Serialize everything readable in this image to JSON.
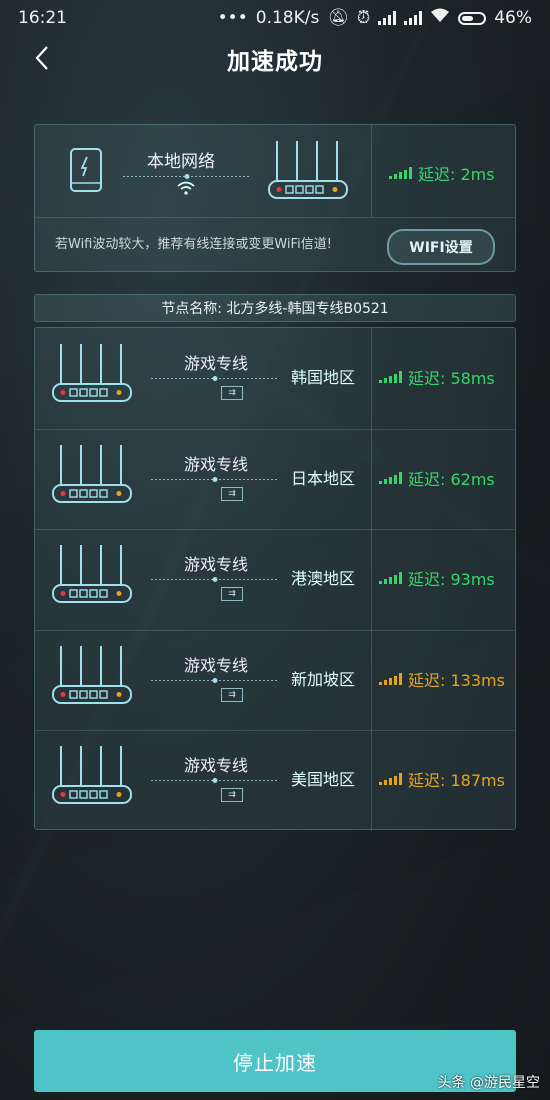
{
  "status_bar": {
    "time": "16:21",
    "network_speed": "0.18K/s",
    "battery": "46%"
  },
  "header": {
    "title": "加速成功",
    "back_icon": "back-chevron-icon"
  },
  "local_network": {
    "label": "本地网络",
    "latency": "延迟: 2ms",
    "latency_color": "#37d46a",
    "tip": "若Wifi波动较大，推荐有线连接或变更WiFi信道!",
    "wifi_button": "WIFI设置"
  },
  "node": {
    "name": "节点名称: 北方多线-韩国专线B0521"
  },
  "routes": [
    {
      "line": "游戏专线",
      "region": "韩国地区",
      "latency": "延迟: 58ms",
      "color": "#37d46a"
    },
    {
      "line": "游戏专线",
      "region": "日本地区",
      "latency": "延迟: 62ms",
      "color": "#37d46a"
    },
    {
      "line": "游戏专线",
      "region": "港澳地区",
      "latency": "延迟: 93ms",
      "color": "#37d46a"
    },
    {
      "line": "游戏专线",
      "region": "新加坡区",
      "latency": "延迟: 133ms",
      "color": "#e6a21e"
    },
    {
      "line": "游戏专线",
      "region": "美国地区",
      "latency": "延迟: 187ms",
      "color": "#e6a21e"
    }
  ],
  "footer": {
    "stop_button": "停止加速",
    "watermark": "头条 @游民星空"
  }
}
